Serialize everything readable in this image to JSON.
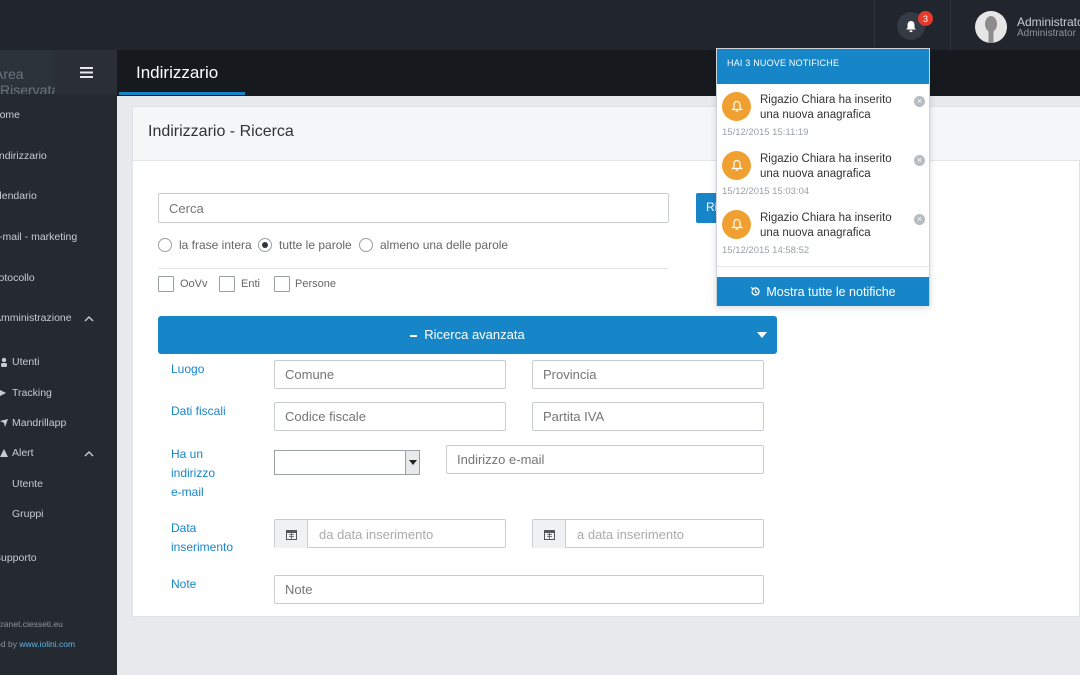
{
  "topbar": {
    "notification_count": "3",
    "user_name": "Administrator",
    "user_role": "Administrator"
  },
  "sidebar": {
    "brand": "Area Riservata",
    "items": [
      {
        "label": "Home",
        "icon": "home-icon"
      },
      {
        "label": "Indirizzario",
        "icon": "address-book-icon"
      },
      {
        "label": "Calendario",
        "icon": "calendar-icon"
      },
      {
        "label": "E-mail - marketing",
        "icon": "mail-icon"
      },
      {
        "label": "Protocollo",
        "icon": "protocol-icon"
      },
      {
        "label": "Amministrazione",
        "icon": "admin-icon"
      }
    ],
    "sub_items": [
      {
        "label": "Utenti",
        "icon": "users-icon"
      },
      {
        "label": "Tracking",
        "icon": "tracking-icon"
      },
      {
        "label": "Mandrillapp",
        "icon": "send-icon"
      },
      {
        "label": "Alert",
        "icon": "alert-icon"
      },
      {
        "label": "Utente",
        "icon": ""
      },
      {
        "label": "Gruppi",
        "icon": ""
      }
    ],
    "supporto": "Supporto",
    "footer_site": "intranet.ciesseti.eu",
    "footer_by": "Developed by",
    "footer_link": "www.iolini.com"
  },
  "header": {
    "title": "Indirizzario"
  },
  "panel": {
    "title": "Indirizzario - Ricerca",
    "search_placeholder": "Cerca",
    "search_button": "Ricerca",
    "radios": [
      {
        "label": "la frase intera",
        "selected": false
      },
      {
        "label": "tutte le parole",
        "selected": true
      },
      {
        "label": "almeno una delle parole",
        "selected": false
      }
    ],
    "checks": [
      "OoVv",
      "Enti",
      "Persone"
    ],
    "advanced_label": "Ricerca avanzata",
    "fields": {
      "luogo": "Luogo",
      "comune": "Comune",
      "provincia": "Provincia",
      "dati_fiscali": "Dati fiscali",
      "codice_fiscale": "Codice fiscale",
      "partita_iva": "Partita IVA",
      "ha_email_1": "Ha un",
      "ha_email_2": "indirizzo",
      "ha_email_3": "e-mail",
      "indirizzo_email": "Indirizzo e-mail",
      "data_1": "Data",
      "data_2": "inserimento",
      "da_data": "da data inserimento",
      "a_data": "a data inserimento",
      "note": "Note",
      "note_placeholder": "Note"
    }
  },
  "notifications": {
    "header": "HAI 3 NUOVE NOTIFICHE",
    "items": [
      {
        "message": "Rigazio Chiara ha inserito una nuova anagrafica",
        "time": "15/12/2015 15:11:19"
      },
      {
        "message": "Rigazio Chiara ha inserito una nuova anagrafica",
        "time": "15/12/2015 15:03:04"
      },
      {
        "message": "Rigazio Chiara ha inserito una nuova anagrafica",
        "time": "15/12/2015 14:58:52"
      }
    ],
    "show_all": "Mostra tutte le notifiche"
  },
  "colors": {
    "accent": "#1786c9",
    "topbar": "#21262e",
    "sidebar": "#252a31",
    "notif_icon": "#f0a030",
    "badge": "#e4392b"
  }
}
